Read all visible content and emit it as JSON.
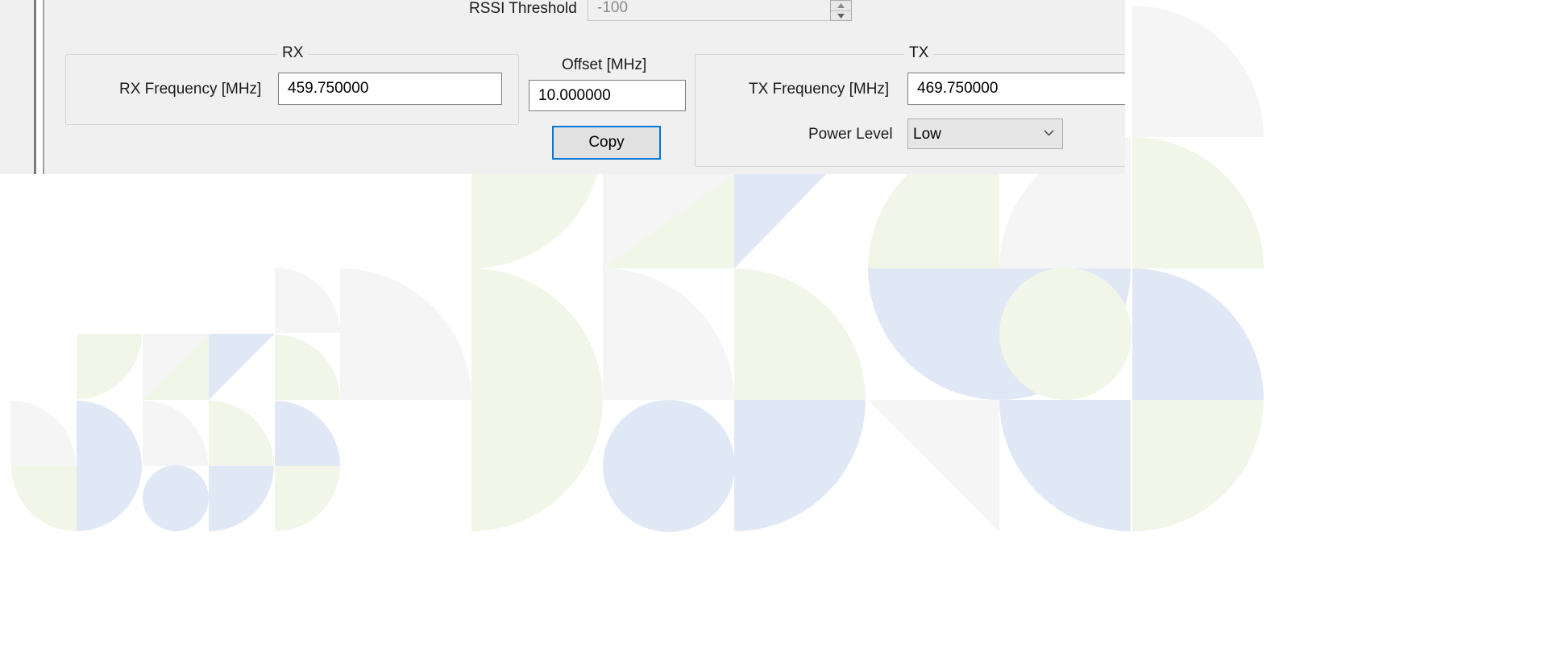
{
  "rssi": {
    "label": "RSSI Threshold",
    "value": "-100"
  },
  "rx": {
    "group_label": "RX",
    "frequency_label": "RX Frequency [MHz]",
    "frequency_value": "459.750000"
  },
  "offset": {
    "label": "Offset [MHz]",
    "value": "10.000000",
    "copy_label": "Copy"
  },
  "tx": {
    "group_label": "TX",
    "frequency_label": "TX Frequency [MHz]",
    "frequency_value": "469.750000",
    "power_label": "Power Level",
    "power_value": "Low"
  },
  "colors": {
    "window_bg": "#f0f0f0",
    "focus_accent": "#0078d7",
    "tile_green": "#f1f6e8",
    "tile_blue": "#e1e8f5",
    "tile_grey": "#f5f5f5"
  },
  "icons": {
    "spin_up": "chevron-up-icon",
    "spin_down": "chevron-down-icon",
    "dropdown": "chevron-down-icon"
  }
}
